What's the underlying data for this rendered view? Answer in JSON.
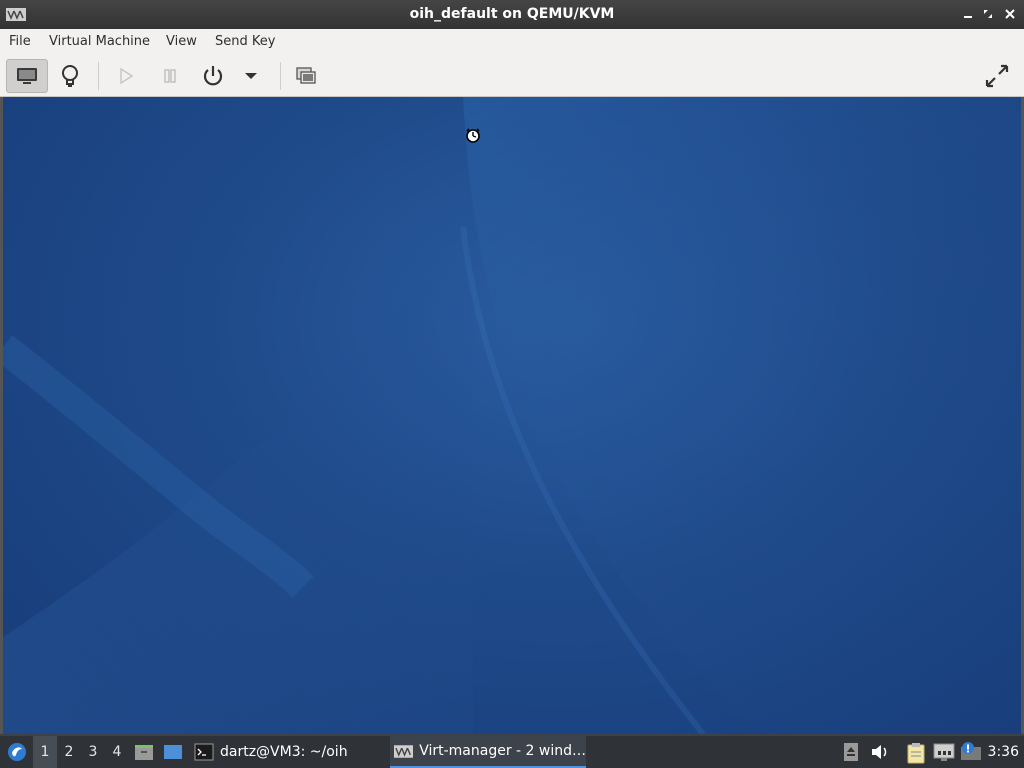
{
  "window": {
    "title": "oih_default on QEMU/KVM",
    "app_icon": "virt-manager-icon",
    "controls": [
      "minimize-icon",
      "maximize-icon",
      "close-icon"
    ]
  },
  "menubar": {
    "items": [
      "File",
      "Virtual Machine",
      "View",
      "Send Key"
    ]
  },
  "toolbar": {
    "buttons": [
      {
        "icon": "console-icon",
        "active": true
      },
      {
        "icon": "lightbulb-icon",
        "active": false
      },
      {
        "icon": "play-icon",
        "enabled": false
      },
      {
        "icon": "pause-icon",
        "enabled": false
      },
      {
        "icon": "power-icon",
        "enabled": true
      },
      {
        "icon": "chevron-down-icon",
        "enabled": true
      },
      {
        "icon": "snapshots-icon",
        "enabled": true
      },
      {
        "icon": "fullscreen-icon",
        "enabled": true
      }
    ]
  },
  "guest": {
    "background": "blue-abstract-wallpaper",
    "cursor": "busy-cursor-icon"
  },
  "taskbar": {
    "start_icon": "start-menu-icon",
    "workspaces": [
      "1",
      "2",
      "3",
      "4"
    ],
    "active_workspace": "1",
    "quicklaunch": [
      "file-manager-icon",
      "show-desktop-icon"
    ],
    "tasks": [
      {
        "icon": "terminal-icon",
        "label": "dartz@VM3: ~/oih",
        "active": false
      },
      {
        "icon": "virt-manager-icon",
        "label": "Virt-manager - 2 wind…",
        "active": true
      }
    ],
    "tray": [
      "eject-icon",
      "volume-icon",
      "clipboard-icon",
      "network-icon",
      "update-notifier-icon"
    ],
    "clock": "3:36"
  },
  "colors": {
    "titlebar": "#3a3a3a",
    "menubar": "#f2f1f0",
    "desktop": "#1f4a8a",
    "taskbar": "#2f3338",
    "accent": "#5294e2"
  }
}
